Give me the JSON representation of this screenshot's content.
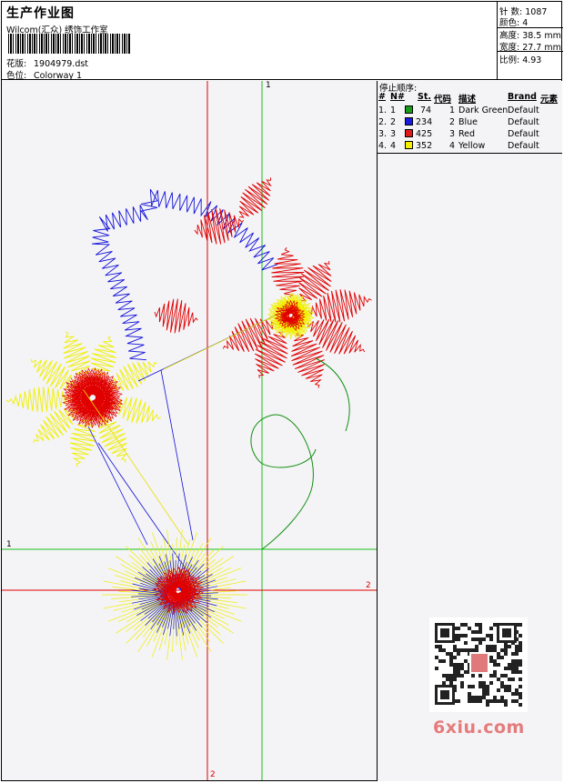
{
  "header": {
    "title": "生产作业图",
    "company": "Wilcom(汇众) 绣饰工作室",
    "pattern_label": "花版:",
    "pattern_value": "1904979.dst",
    "colorway_label": "色位:",
    "colorway_value": "Colorway 1"
  },
  "stats": {
    "stitches_label": "针 数:",
    "stitches_value": "1087",
    "colors_label": "颜色:",
    "colors_value": "4",
    "height_label": "高度:",
    "height_value": "38.5 mm",
    "width_label": "宽度:",
    "width_value": "27.7 mm",
    "scale_label": "比例:",
    "scale_value": "4.93"
  },
  "stop_sequence": {
    "title": "停止顺序:",
    "columns": [
      "#",
      "N#",
      "St.",
      "代码",
      "描述",
      "Brand",
      "元素"
    ],
    "rows": [
      {
        "idx": "1.",
        "n": "1",
        "st": "74",
        "code": "1",
        "desc": "Dark Green",
        "brand": "Default",
        "color": "#1a9a1a"
      },
      {
        "idx": "2.",
        "n": "2",
        "st": "234",
        "code": "2",
        "desc": "Blue",
        "brand": "Default",
        "color": "#1a1ae0"
      },
      {
        "idx": "3.",
        "n": "3",
        "st": "425",
        "code": "3",
        "desc": "Red",
        "brand": "Default",
        "color": "#e01a1a"
      },
      {
        "idx": "4.",
        "n": "4",
        "st": "352",
        "code": "4",
        "desc": "Yellow",
        "brand": "Default",
        "color": "#f5f000"
      }
    ]
  },
  "axis_labels": {
    "green_v": "1",
    "green_h": "1",
    "red_h": "2",
    "red_v": "2"
  },
  "watermark": "6xiu.com",
  "colors": {
    "green": "#18c018",
    "red": "#e00000",
    "blue": "#1010d8",
    "yellow": "#f0f000",
    "dark_green": "#109010"
  }
}
